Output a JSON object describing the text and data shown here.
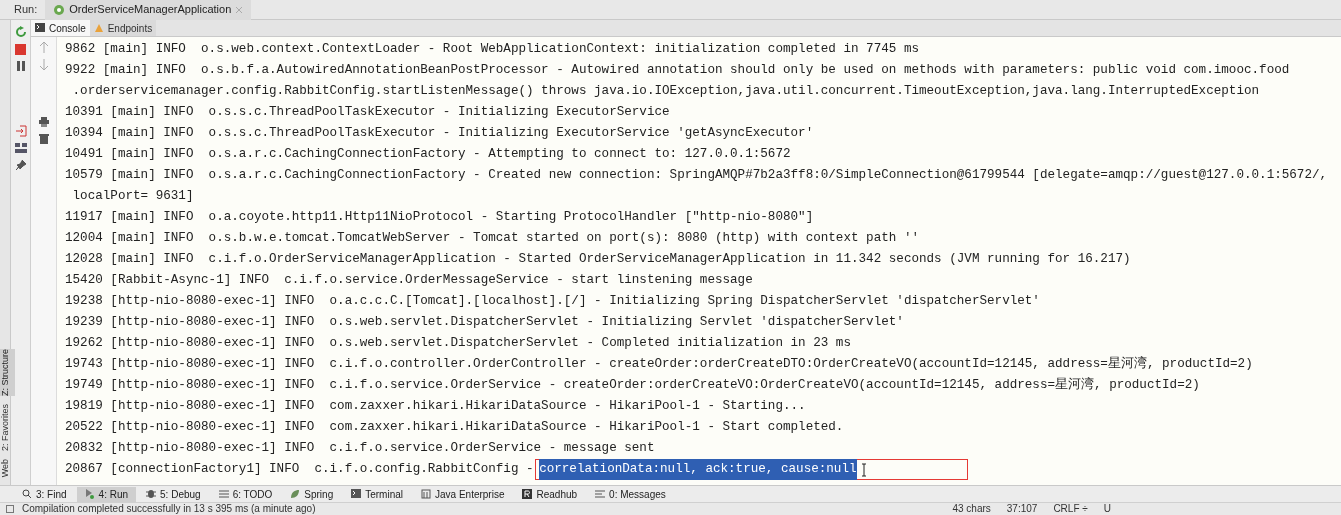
{
  "run_bar": {
    "label": "Run:",
    "tab": "OrderServiceManagerApplication"
  },
  "console_tabs": [
    {
      "label": "Console",
      "kind": "console",
      "selected": true
    },
    {
      "label": "Endpoints",
      "kind": "endpoints",
      "selected": false
    }
  ],
  "side_tabs": [
    {
      "label": "Z: Structure",
      "selected": true
    },
    {
      "label": "2: Favorites",
      "selected": false
    },
    {
      "label": "Web",
      "selected": false
    }
  ],
  "console": {
    "lines": [
      {
        "kind": "plain",
        "text": "9862 [main] INFO  o.s.web.context.ContextLoader - Root WebApplicationContext: initialization completed in 7745 ms"
      },
      {
        "kind": "plain",
        "text": "9922 [main] INFO  o.s.b.f.a.AutowiredAnnotationBeanPostProcessor - Autowired annotation should only be used on methods with parameters: public void com.imooc.food"
      },
      {
        "kind": "plain",
        "text": " .orderservicemanager.config.RabbitConfig.startListenMessage() throws java.io.IOException,java.util.concurrent.TimeoutException,java.lang.InterruptedException"
      },
      {
        "kind": "plain",
        "text": "10391 [main] INFO  o.s.s.c.ThreadPoolTaskExecutor - Initializing ExecutorService"
      },
      {
        "kind": "plain",
        "text": "10394 [main] INFO  o.s.s.c.ThreadPoolTaskExecutor - Initializing ExecutorService 'getAsyncExecutor'"
      },
      {
        "kind": "plain",
        "text": "10491 [main] INFO  o.s.a.r.c.CachingConnectionFactory - Attempting to connect to: 127.0.0.1:5672"
      },
      {
        "kind": "plain",
        "text": "10579 [main] INFO  o.s.a.r.c.CachingConnectionFactory - Created new connection: SpringAMQP#7b2a3ff8:0/SimpleConnection@61799544 [delegate=amqp://guest@127.0.0.1:5672/,"
      },
      {
        "kind": "plain",
        "text": " localPort= 9631]"
      },
      {
        "kind": "plain",
        "text": "11917 [main] INFO  o.a.coyote.http11.Http11NioProtocol - Starting ProtocolHandler [\"http-nio-8080\"]"
      },
      {
        "kind": "plain",
        "text": "12004 [main] INFO  o.s.b.w.e.tomcat.TomcatWebServer - Tomcat started on port(s): 8080 (http) with context path ''"
      },
      {
        "kind": "plain",
        "text": "12028 [main] INFO  c.i.f.o.OrderServiceManagerApplication - Started OrderServiceManagerApplication in 11.342 seconds (JVM running for 16.217)"
      },
      {
        "kind": "plain",
        "text": "15420 [Rabbit-Async-1] INFO  c.i.f.o.service.OrderMessageService - start linstening message"
      },
      {
        "kind": "plain",
        "text": "19238 [http-nio-8080-exec-1] INFO  o.a.c.c.C.[Tomcat].[localhost].[/] - Initializing Spring DispatcherServlet 'dispatcherServlet'"
      },
      {
        "kind": "plain",
        "text": "19239 [http-nio-8080-exec-1] INFO  o.s.web.servlet.DispatcherServlet - Initializing Servlet 'dispatcherServlet'"
      },
      {
        "kind": "plain",
        "text": "19262 [http-nio-8080-exec-1] INFO  o.s.web.servlet.DispatcherServlet - Completed initialization in 23 ms"
      },
      {
        "kind": "plain",
        "text": "19743 [http-nio-8080-exec-1] INFO  c.i.f.o.controller.OrderController - createOrder:orderCreateDTO:OrderCreateVO(accountId=12145, address=星河湾, productId=2)"
      },
      {
        "kind": "plain",
        "text": "19749 [http-nio-8080-exec-1] INFO  c.i.f.o.service.OrderService - createOrder:orderCreateVO:OrderCreateVO(accountId=12145, address=星河湾, productId=2)"
      },
      {
        "kind": "plain",
        "text": "19819 [http-nio-8080-exec-1] INFO  com.zaxxer.hikari.HikariDataSource - HikariPool-1 - Starting..."
      },
      {
        "kind": "plain",
        "text": "20522 [http-nio-8080-exec-1] INFO  com.zaxxer.hikari.HikariDataSource - HikariPool-1 - Start completed."
      },
      {
        "kind": "plain",
        "text": "20832 [http-nio-8080-exec-1] INFO  c.i.f.o.service.OrderService - message sent"
      },
      {
        "kind": "selection",
        "text": "20867 [connectionFactory1] INFO  c.i.f.o.config.RabbitConfig - ",
        "selection": "correlationData:null, ack:true, cause:null",
        "boxed": true
      }
    ]
  },
  "tool_windows": [
    {
      "label": "3: Find",
      "kind": "search",
      "selected": false
    },
    {
      "label": "4: Run",
      "kind": "run",
      "selected": true
    },
    {
      "label": "5: Debug",
      "kind": "bug",
      "selected": false
    },
    {
      "label": "6: TODO",
      "kind": "list",
      "selected": false
    },
    {
      "label": "Spring",
      "kind": "leaf",
      "selected": false
    },
    {
      "label": "Terminal",
      "kind": "terminal",
      "selected": false
    },
    {
      "label": "Java Enterprise",
      "kind": "enterprise",
      "selected": false
    },
    {
      "label": "Readhub",
      "kind": "r",
      "selected": false
    },
    {
      "label": "0: Messages",
      "kind": "lines",
      "selected": false
    }
  ],
  "status_bar": {
    "message": "Compilation completed successfully in 13 s 395 ms (a minute ago)",
    "items": [
      "43 chars",
      "37:107",
      "CRLF ÷",
      "U"
    ]
  }
}
